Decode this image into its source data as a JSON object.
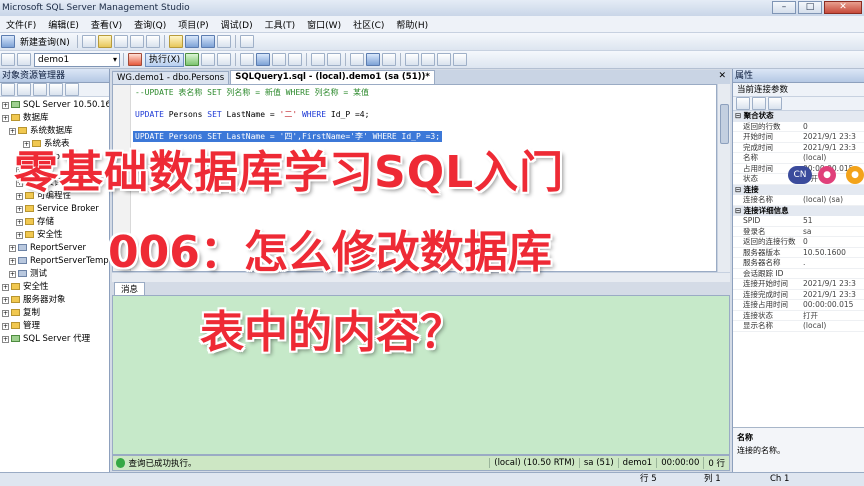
{
  "window": {
    "title": "Microsoft SQL Server Management Studio"
  },
  "menu": [
    "文件(F)",
    "编辑(E)",
    "查看(V)",
    "查询(Q)",
    "项目(P)",
    "调试(D)",
    "工具(T)",
    "窗口(W)",
    "社区(C)",
    "帮助(H)"
  ],
  "toolbar": {
    "new_query": "新建查询(N)",
    "database": "demo1",
    "execute": "执行(X)"
  },
  "object_explorer": {
    "title": "对象资源管理器",
    "items": [
      {
        "label": "SQL Server 10.50.1600 - sa)",
        "indent": 0,
        "icon": "server-icon"
      },
      {
        "label": "数据库",
        "indent": 0,
        "icon": "folder-icon"
      },
      {
        "label": "系统数据库",
        "indent": 1,
        "icon": "folder-icon"
      },
      {
        "label": "系统表",
        "indent": 3,
        "icon": "folder-icon"
      },
      {
        "label": "dbo.Persons",
        "indent": 3,
        "icon": "table-icon"
      },
      {
        "label": "视图",
        "indent": 2,
        "icon": "folder-icon"
      },
      {
        "label": "同义词",
        "indent": 2,
        "icon": "folder-icon"
      },
      {
        "label": "可编程性",
        "indent": 2,
        "icon": "folder-icon"
      },
      {
        "label": "Service Broker",
        "indent": 2,
        "icon": "folder-icon"
      },
      {
        "label": "存储",
        "indent": 2,
        "icon": "folder-icon"
      },
      {
        "label": "安全性",
        "indent": 2,
        "icon": "folder-icon"
      },
      {
        "label": "ReportServer",
        "indent": 1,
        "icon": "database-icon"
      },
      {
        "label": "ReportServerTempDB",
        "indent": 1,
        "icon": "database-icon"
      },
      {
        "label": "测试",
        "indent": 1,
        "icon": "database-icon"
      },
      {
        "label": "安全性",
        "indent": 0,
        "icon": "folder-icon"
      },
      {
        "label": "服务器对象",
        "indent": 0,
        "icon": "folder-icon"
      },
      {
        "label": "复制",
        "indent": 0,
        "icon": "folder-icon"
      },
      {
        "label": "管理",
        "indent": 0,
        "icon": "folder-icon"
      },
      {
        "label": "SQL Server 代理",
        "indent": 0,
        "icon": "agent-icon"
      }
    ]
  },
  "tabs": [
    {
      "label": "WG.demo1 - dbo.Persons",
      "active": false
    },
    {
      "label": "SQLQuery1.sql - (local).demo1 (sa (51))*",
      "active": true
    }
  ],
  "editor": {
    "comment": "--UPDATE 表名称 SET 列名称 = 新值   WHERE 列名称 = 某值",
    "line1": {
      "kw1": "UPDATE",
      "t1": " Persons ",
      "kw2": "SET",
      "t2": " LastName = ",
      "s1": "'二'",
      "t3": " ",
      "kw3": "WHERE",
      "t4": " Id_P =4;"
    },
    "line2": {
      "kw1": "UPDATE",
      "t1": " Persons ",
      "kw2": "SET",
      "t2": " LastName = ",
      "s1": "'四'",
      "t3": ",FirstName=",
      "s2": "'李'",
      "t4": " ",
      "kw3": "WHERE",
      "t5": " Id_P =3;"
    }
  },
  "results": {
    "tab_label": "消息",
    "status": "查询已成功执行。",
    "server": "(local) (10.50 RTM)",
    "user": "sa (51)",
    "database": "demo1",
    "elapsed": "00:00:00",
    "rows": "0 行"
  },
  "statusbar": {
    "line": "行 5",
    "col": "列 1",
    "ch": "Ch 1"
  },
  "properties": {
    "title": "属性",
    "subtitle": "当前连接参数",
    "rows": [
      {
        "type": "cat",
        "label": "聚合状态"
      },
      {
        "type": "row",
        "k": "返回的行数",
        "v": "0"
      },
      {
        "type": "row",
        "k": "开始时间",
        "v": "2021/9/1 23:3"
      },
      {
        "type": "row",
        "k": "完成时间",
        "v": "2021/9/1 23:3"
      },
      {
        "type": "row",
        "k": "名称",
        "v": "(local)"
      },
      {
        "type": "row",
        "k": "占用时间",
        "v": "00:00:00.015"
      },
      {
        "type": "row",
        "k": "状态",
        "v": "打开"
      },
      {
        "type": "cat",
        "label": "连接"
      },
      {
        "type": "row",
        "k": "连接名称",
        "v": "(local) (sa)"
      },
      {
        "type": "cat",
        "label": "连接详细信息"
      },
      {
        "type": "row",
        "k": "SPID",
        "v": "51"
      },
      {
        "type": "row",
        "k": "登录名",
        "v": "sa"
      },
      {
        "type": "row",
        "k": "返回的连接行数",
        "v": "0"
      },
      {
        "type": "row",
        "k": "服务器版本",
        "v": "10.50.1600"
      },
      {
        "type": "row",
        "k": "服务器名称",
        "v": "."
      },
      {
        "type": "row",
        "k": "会话跟踪 ID",
        "v": ""
      },
      {
        "type": "row",
        "k": "连接开始时间",
        "v": "2021/9/1 23:3"
      },
      {
        "type": "row",
        "k": "连接完成时间",
        "v": "2021/9/1 23:3"
      },
      {
        "type": "row",
        "k": "连接占用时间",
        "v": "00:00:00.015"
      },
      {
        "type": "row",
        "k": "连接状态",
        "v": "打开"
      },
      {
        "type": "row",
        "k": "显示名称",
        "v": "(local)"
      }
    ],
    "desc_title": "名称",
    "desc_text": "连接的名称。"
  },
  "ime": {
    "lang": "CN"
  },
  "overlay": {
    "line1": "零基础数据库学习SQL入门",
    "line2": "006：怎么修改数据库",
    "line3": "表中的内容？"
  },
  "colors": {
    "overlay_text": "#ee2a35",
    "selection": "#3c78d8",
    "results_bg": "#c6e9c9"
  }
}
